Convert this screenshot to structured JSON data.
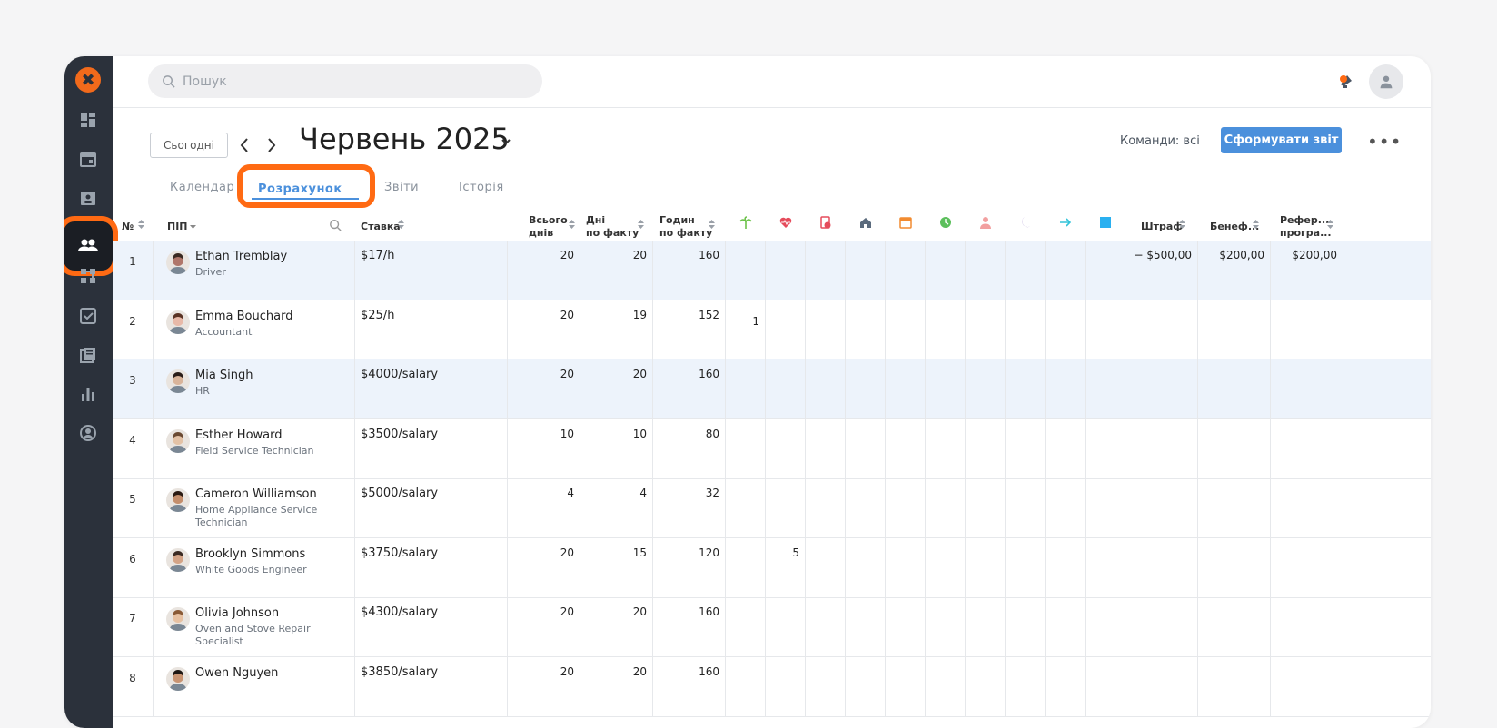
{
  "search": {
    "placeholder": "Пошук"
  },
  "toolbar": {
    "today_label": "Сьогодні",
    "prev_label": "‹",
    "next_label": "›",
    "month": "Червень 2025",
    "teams_label": "Команди: всі",
    "report_button": "Сформувати звіт",
    "more_label": "•••"
  },
  "tabs": [
    "Календар",
    "Розрахунок",
    "Звіти",
    "Історія"
  ],
  "active_tab": "Розрахунок",
  "columns": {
    "num": "№",
    "name": "ПІП",
    "rate": "Ставка",
    "total_days_1": "Всього",
    "total_days_2": "днів",
    "days_fact_1": "Дні",
    "days_fact_2": "по факту",
    "hours_fact_1": "Годин",
    "hours_fact_2": "по факту",
    "fine": "Штраф",
    "benefit": "Бенеф...",
    "referral_1": "Рефер...",
    "referral_2": "програ..."
  },
  "icon_columns": [
    {
      "icon": "palm-tree-icon",
      "color": "#6cc24a"
    },
    {
      "icon": "heart-pulse-icon",
      "color": "#e54b5b"
    },
    {
      "icon": "medical-document-icon",
      "color": "#e54b5b"
    },
    {
      "icon": "home-icon",
      "color": "#5b6b7d"
    },
    {
      "icon": "calendar-icon",
      "color": "#f28b30"
    },
    {
      "icon": "clock-icon",
      "color": "#5cbf5c"
    },
    {
      "icon": "person-icon",
      "color": "#f2a0a0"
    },
    {
      "icon": "moon-icon",
      "color": "#7b5cb8"
    },
    {
      "icon": "arrow-right-icon",
      "color": "#34c4d9"
    },
    {
      "icon": "square-icon",
      "color": "#2ab0f0"
    }
  ],
  "employees": [
    {
      "n": "1",
      "name": "Ethan Tremblay",
      "role": "Driver",
      "rate": "$17/h",
      "total": "20",
      "days": "20",
      "hours": "160",
      "ic1": "",
      "ic2": "",
      "fine": "− $500,00",
      "benefit": "$200,00",
      "referral": "$200,00",
      "skin": "#b0766a",
      "hair": "#3a2a22"
    },
    {
      "n": "2",
      "name": "Emma Bouchard",
      "role": "Accountant",
      "rate": "$25/h",
      "total": "20",
      "days": "19",
      "hours": "152",
      "ic1": "1",
      "ic2": "",
      "fine": "",
      "benefit": "",
      "referral": "",
      "skin": "#e8b9a8",
      "hair": "#5a3324"
    },
    {
      "n": "3",
      "name": "Mia Singh",
      "role": "HR",
      "rate": "$4000/salary",
      "total": "20",
      "days": "20",
      "hours": "160",
      "ic1": "",
      "ic2": "",
      "fine": "",
      "benefit": "",
      "referral": "",
      "skin": "#d9b49a",
      "hair": "#2a1d18"
    },
    {
      "n": "4",
      "name": "Esther Howard",
      "role": "Field Service Technician",
      "rate": "$3500/salary",
      "total": "10",
      "days": "10",
      "hours": "80",
      "ic1": "",
      "ic2": "",
      "fine": "",
      "benefit": "",
      "referral": "",
      "skin": "#e3c2a6",
      "hair": "#6b4a32"
    },
    {
      "n": "5",
      "name": "Cameron Williamson",
      "role": "Home Appliance Service Technician",
      "rate": "$5000/salary",
      "total": "4",
      "days": "4",
      "hours": "32",
      "ic1": "",
      "ic2": "",
      "fine": "",
      "benefit": "",
      "referral": "",
      "skin": "#c48e6c",
      "hair": "#2b1a12"
    },
    {
      "n": "6",
      "name": "Brooklyn Simmons",
      "role": "White Goods Engineer",
      "rate": "$3750/salary",
      "total": "20",
      "days": "15",
      "hours": "120",
      "ic1": "",
      "ic2": "5",
      "fine": "",
      "benefit": "",
      "referral": "",
      "skin": "#d3a386",
      "hair": "#3b2a22"
    },
    {
      "n": "7",
      "name": "Olivia Johnson",
      "role": "Oven and Stove Repair Specialist",
      "rate": "$4300/salary",
      "total": "20",
      "days": "20",
      "hours": "160",
      "ic1": "",
      "ic2": "",
      "fine": "",
      "benefit": "",
      "referral": "",
      "skin": "#e7c1a2",
      "hair": "#8a5a36"
    },
    {
      "n": "8",
      "name": "Owen Nguyen",
      "role": "",
      "rate": "$3850/salary",
      "total": "20",
      "days": "20",
      "hours": "160",
      "ic1": "",
      "ic2": "",
      "fine": "",
      "benefit": "",
      "referral": "",
      "skin": "#c99472",
      "hair": "#1f1712"
    }
  ],
  "colors": {
    "accent": "#4b90dc",
    "highlight": "#ff6a13",
    "sidebar": "#2b313b",
    "row_alt": "#edf3fb"
  }
}
